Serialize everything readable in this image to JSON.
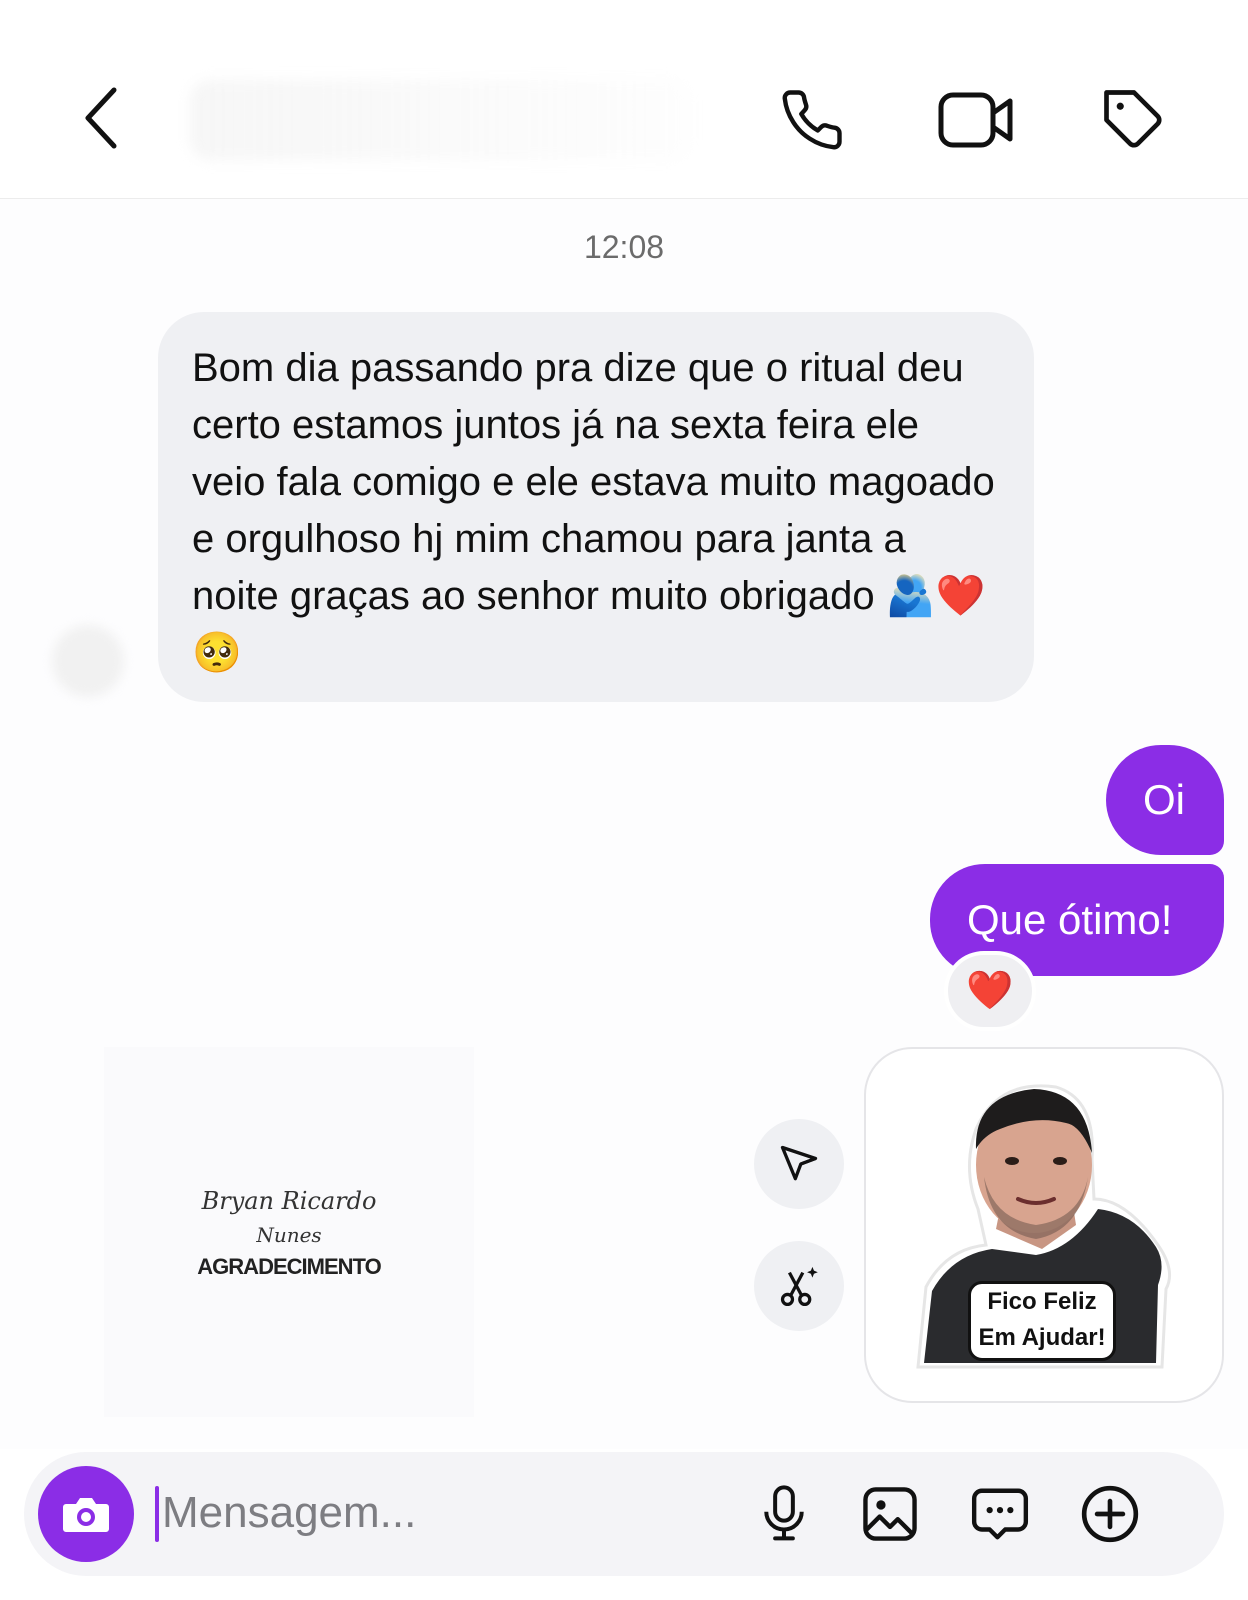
{
  "header": {
    "back_icon": "chevron-left-icon",
    "actions": [
      "phone-icon",
      "video-icon",
      "tag-icon"
    ]
  },
  "chat": {
    "timestamp": "12:08",
    "incoming": {
      "text": "Bom dia passando pra dize que o ritual deu certo estamos juntos já na sexta feira ele veio fala comigo e ele estava muito magoado e orgulhoso hj mim chamou para janta a noite graças ao senhor muito obrigado 🫂❤️🥺"
    },
    "outgoing": [
      {
        "text": "Oi"
      },
      {
        "text": "Que ótimo!",
        "reaction": "❤️"
      }
    ],
    "shared_post": {
      "signature_line1": "Bryan Ricardo",
      "signature_line2": "Nunes",
      "caption": "AGRADECIMENTO"
    },
    "sticker": {
      "line1": "Fico Feliz",
      "line2": "Em Ajudar!"
    }
  },
  "composer": {
    "placeholder": "Mensagem...",
    "icons": [
      "camera-icon",
      "microphone-icon",
      "image-icon",
      "chat-bubble-icon",
      "plus-circle-icon"
    ]
  },
  "colors": {
    "accent": "#8b2de6",
    "incoming_bubble": "#eff0f3"
  }
}
